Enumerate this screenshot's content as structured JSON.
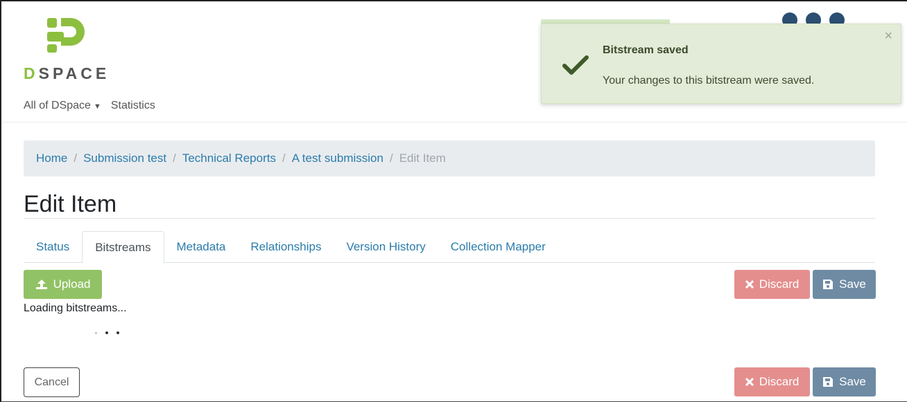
{
  "brand": {
    "logo_icon": "dspace-logo-icon",
    "name_first": "D",
    "name_rest": "SPACE"
  },
  "nav": {
    "items": [
      {
        "label": "All of DSpace",
        "has_caret": true
      },
      {
        "label": "Statistics"
      }
    ]
  },
  "toast": {
    "title": "Bitstream saved",
    "message": "Your changes to this bitstream were saved.",
    "close": "×",
    "icon": "checkmark-icon"
  },
  "breadcrumb": {
    "items": [
      {
        "label": "Home"
      },
      {
        "label": "Submission test"
      },
      {
        "label": "Technical Reports"
      },
      {
        "label": "A test submission"
      },
      {
        "label": "Edit Item",
        "active": true
      }
    ],
    "separator": "/"
  },
  "page": {
    "title": "Edit Item"
  },
  "tabs": [
    {
      "label": "Status"
    },
    {
      "label": "Bitstreams",
      "active": true
    },
    {
      "label": "Metadata"
    },
    {
      "label": "Relationships"
    },
    {
      "label": "Version History"
    },
    {
      "label": "Collection Mapper"
    }
  ],
  "actions": {
    "upload_label": "Upload",
    "discard_label": "Discard",
    "save_label": "Save",
    "cancel_label": "Cancel"
  },
  "status": {
    "loading_text": "Loading bitstreams..."
  },
  "colors": {
    "accent_green": "#92c266",
    "discard_red": "#e58e8e",
    "save_blue": "#6f8ba4",
    "link_blue": "#2b7cab",
    "toast_bg": "#e3ecd8"
  }
}
